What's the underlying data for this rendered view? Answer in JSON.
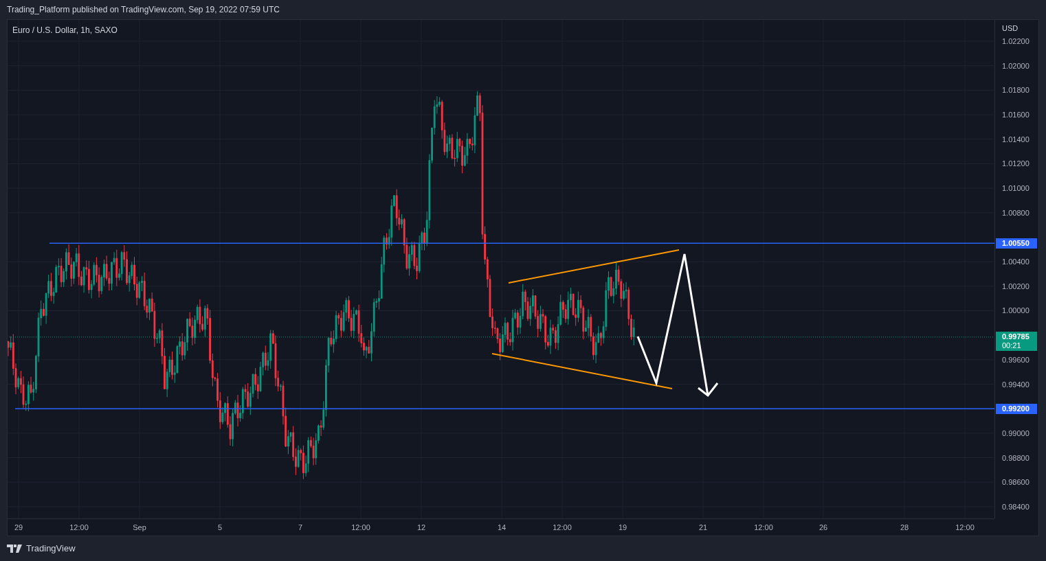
{
  "header": {
    "text": "Trading_Platform published on TradingView.com, Sep 19, 2022 07:59 UTC"
  },
  "chart": {
    "legend": "Euro / U.S. Dollar, 1h, SAXO",
    "currency": "USD",
    "price_ticks": [
      "1.02200",
      "1.02000",
      "1.01800",
      "1.01600",
      "1.01400",
      "1.01200",
      "1.01000",
      "1.00800",
      "1.00400",
      "1.00200",
      "1.00000",
      "0.99600",
      "0.99400",
      "0.99000",
      "0.98800",
      "0.98600",
      "0.98400"
    ],
    "time_ticks": [
      "29",
      "12:00",
      "Sep",
      "5",
      "7",
      "12:00",
      "12",
      "14",
      "12:00",
      "19",
      "21",
      "12:00",
      "26",
      "28",
      "12:00"
    ],
    "horizontal_lines": [
      {
        "label": "1.00550"
      },
      {
        "label": "0.99200"
      }
    ],
    "last_price": {
      "label": "0.99785",
      "countdown": "00:21"
    }
  },
  "footer": {
    "logo_text": "TradingView"
  }
}
